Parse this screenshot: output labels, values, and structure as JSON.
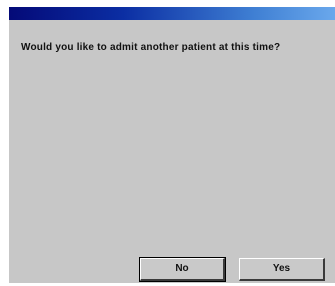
{
  "dialog": {
    "message": "Would you like to admit another patient at this time?",
    "buttons": {
      "no_label": "No",
      "yes_label": "Yes"
    }
  },
  "colors": {
    "title_bar_start": "#040a78",
    "title_bar_end": "#6aa8ec",
    "dialog_background": "#c7c7c7"
  }
}
